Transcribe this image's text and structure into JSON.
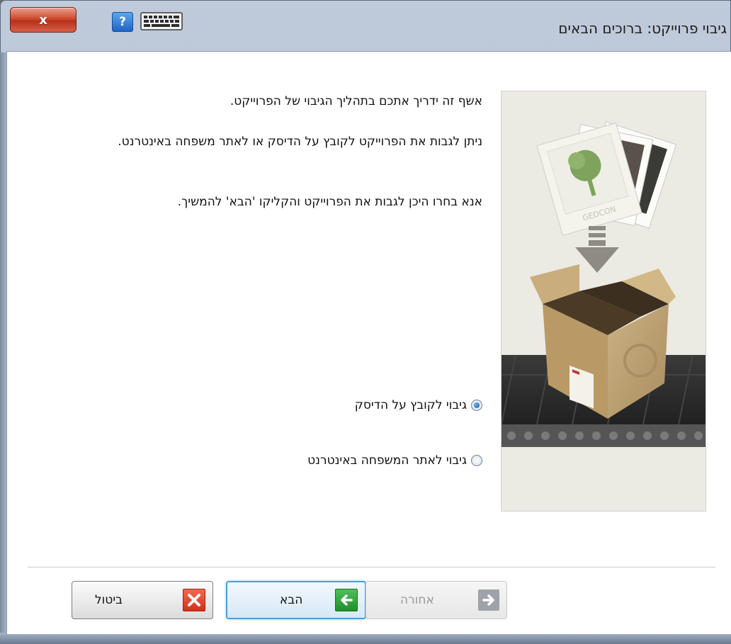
{
  "window": {
    "title": "גיבוי פרוייקט: ברוכים הבאים",
    "close_label": "x"
  },
  "toolbar": {
    "help_label": "?"
  },
  "intro": {
    "line1": "אשף זה ידריך אתכם בתהליך הגיבוי של הפרוייקט.",
    "line2": "ניתן לגבות את הפרוייקט לקובץ על הדיסק או לאתר משפחה באינטרנט.",
    "line3": "אנא בחרו היכן לגבות את הפרוייקט והקליקו 'הבא' להמשיך."
  },
  "illustration": {
    "card_text": "GEDCON"
  },
  "options": [
    {
      "label": "גיבוי לקובץ על הדיסק",
      "selected": true
    },
    {
      "label": "גיבוי לאתר המשפחה באינטרנט",
      "selected": false
    }
  ],
  "buttons": {
    "back_label": "אחורה",
    "next_label": "הבא",
    "cancel_label": "ביטול"
  },
  "colors": {
    "accent": "#4aa0e0",
    "next_icon": "#2a9d36",
    "cancel_icon": "#e0432b"
  }
}
